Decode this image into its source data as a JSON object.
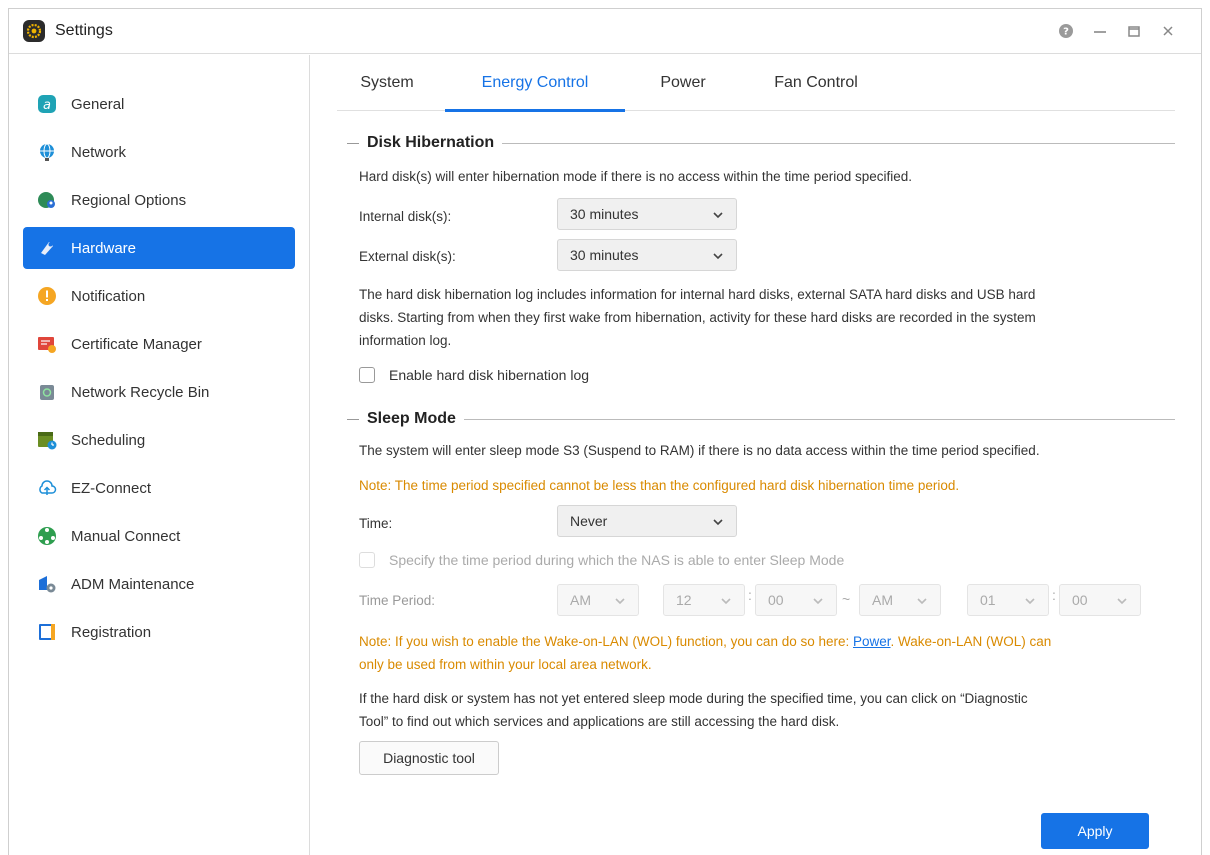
{
  "window": {
    "title": "Settings"
  },
  "sidebar": {
    "items": [
      {
        "label": "General",
        "icon": "general-icon"
      },
      {
        "label": "Network",
        "icon": "network-icon"
      },
      {
        "label": "Regional Options",
        "icon": "regional-options-icon"
      },
      {
        "label": "Hardware",
        "icon": "hardware-icon",
        "active": true
      },
      {
        "label": "Notification",
        "icon": "notification-icon"
      },
      {
        "label": "Certificate Manager",
        "icon": "certificate-icon"
      },
      {
        "label": "Network Recycle Bin",
        "icon": "recycle-bin-icon"
      },
      {
        "label": "Scheduling",
        "icon": "scheduling-icon"
      },
      {
        "label": "EZ-Connect",
        "icon": "cloud-icon"
      },
      {
        "label": "Manual Connect",
        "icon": "manual-connect-icon"
      },
      {
        "label": "ADM Maintenance",
        "icon": "maintenance-icon"
      },
      {
        "label": "Registration",
        "icon": "registration-icon"
      }
    ]
  },
  "tabs": [
    {
      "label": "System"
    },
    {
      "label": "Energy Control",
      "active": true
    },
    {
      "label": "Power"
    },
    {
      "label": "Fan Control"
    }
  ],
  "disk_hibernation": {
    "title": "Disk Hibernation",
    "description": "Hard disk(s) will enter hibernation mode if there is no access within the time period specified.",
    "internal_label": "Internal disk(s):",
    "internal_value": "30 minutes",
    "external_label": "External disk(s):",
    "external_value": "30 minutes",
    "log_info_1": "The hard disk hibernation log includes information for internal hard disks, external SATA hard disks and USB hard",
    "log_info_2": "disks. Starting from when they first wake from hibernation, activity for these hard disks are recorded in the system",
    "log_info_3": "information log.",
    "log_checkbox_label": "Enable hard disk hibernation log"
  },
  "sleep_mode": {
    "title": "Sleep Mode",
    "description": "The system will enter sleep mode S3 (Suspend to RAM) if there is no data access within the time period specified.",
    "note": "Note: The time period specified cannot be less than the configured hard disk hibernation time period.",
    "time_label": "Time:",
    "time_value": "Never",
    "period_checkbox_label": "Specify the time period during which the NAS is able to enter Sleep Mode",
    "time_period_label": "Time Period:",
    "start_ampm": "AM",
    "start_hour": "12",
    "start_minute": "00",
    "range_sep": "~",
    "end_ampm": "AM",
    "end_hour": "01",
    "end_minute": "00",
    "colon": ":",
    "wol_note_prefix": "Note: If you wish to enable the Wake-on-LAN (WOL) function, you can do so here: ",
    "wol_link": "Power",
    "wol_note_suffix": ". Wake-on-LAN (WOL) can",
    "wol_note_line2": "only be used from within your local area network.",
    "diag_info_1": "If the hard disk or system has not yet entered sleep mode during the specified time, you can click on “Diagnostic",
    "diag_info_2": "Tool” to find out which services and applications are still accessing the hard disk.",
    "diag_button": "Diagnostic tool"
  },
  "apply_button": "Apply",
  "colors": {
    "accent": "#1673e6",
    "note": "#d98a00"
  }
}
